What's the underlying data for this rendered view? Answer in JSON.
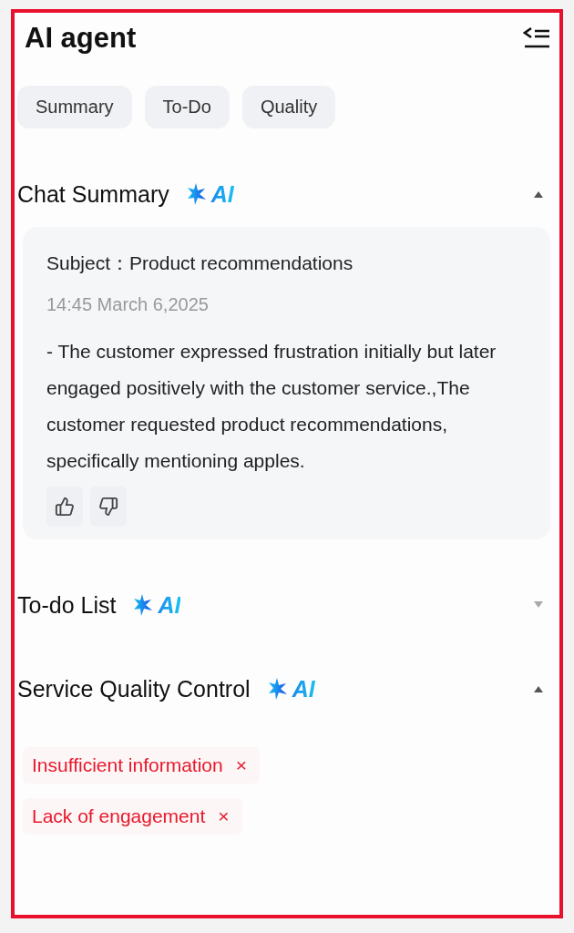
{
  "title": "AI agent",
  "tabs": [
    {
      "label": "Summary"
    },
    {
      "label": "To-Do"
    },
    {
      "label": "Quality"
    }
  ],
  "sections": [
    {
      "kind": "summary",
      "title": "Chat Summary",
      "badge": "AI",
      "expanded": true,
      "subject": "Subject：Product recommendations",
      "time": "14:45 March 6,2025",
      "text": "- The customer expressed frustration initially but later engaged positively with the customer service.,The customer requested product recommendations, specifically mentioning apples."
    },
    {
      "title": "To-do List",
      "badge": "AI",
      "expanded": false
    },
    {
      "kind": "tags",
      "title": "Service Quality Control",
      "badge": "AI",
      "expanded": true,
      "tags": [
        {
          "label": "Insufficient information",
          "remove": "×"
        },
        {
          "label": "Lack of engagement",
          "remove": "×"
        }
      ]
    }
  ]
}
